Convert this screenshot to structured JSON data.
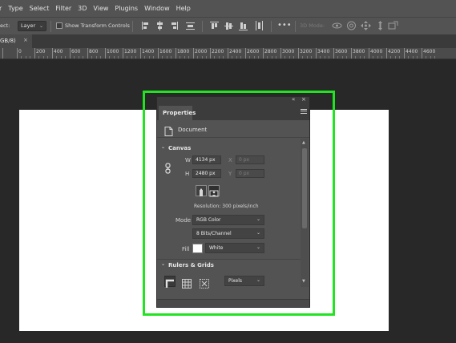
{
  "menu": [
    "r",
    "Type",
    "Select",
    "Filter",
    "3D",
    "View",
    "Plugins",
    "Window",
    "Help"
  ],
  "options_bar": {
    "select_label": "ect:",
    "select_value": "Layer",
    "transform_controls_label": "Show Transform Controls",
    "mode_3d_label": "3D Mode:",
    "more_label": "•••"
  },
  "document_tab": {
    "title": "GB/8)",
    "close": "×"
  },
  "ruler": {
    "labels": [
      "0",
      "200",
      "400",
      "600",
      "800",
      "1000",
      "1200",
      "1400",
      "1600",
      "1800",
      "2000",
      "2200",
      "2400",
      "2600",
      "2800",
      "3000",
      "3200",
      "3400",
      "3600",
      "3800",
      "4000",
      "4200",
      "4400",
      "4600"
    ]
  },
  "properties": {
    "tab_label": "Properties",
    "collapse_glyph": "«",
    "close_glyph": "×",
    "document_label": "Document",
    "canvas_section": {
      "title": "Canvas",
      "w_label": "W",
      "w_value": "4134 px",
      "h_label": "H",
      "h_value": "2480 px",
      "x_label": "X",
      "x_value": "0 px",
      "y_label": "Y",
      "y_value": "0 px",
      "resolution": "Resolution: 300 pixels/inch",
      "mode_label": "Mode",
      "mode_value": "RGB Color",
      "depth_value": "8 Bits/Channel",
      "fill_label": "Fill",
      "fill_value": "White",
      "fill_color": "#ffffff"
    },
    "rulers_section": {
      "title": "Rulers & Grids",
      "units_value": "Pixels"
    }
  },
  "colors": {
    "highlight": "#22e322",
    "panel_bg": "#535353",
    "canvas_bg": "#ffffff",
    "workspace_bg": "#282828"
  }
}
